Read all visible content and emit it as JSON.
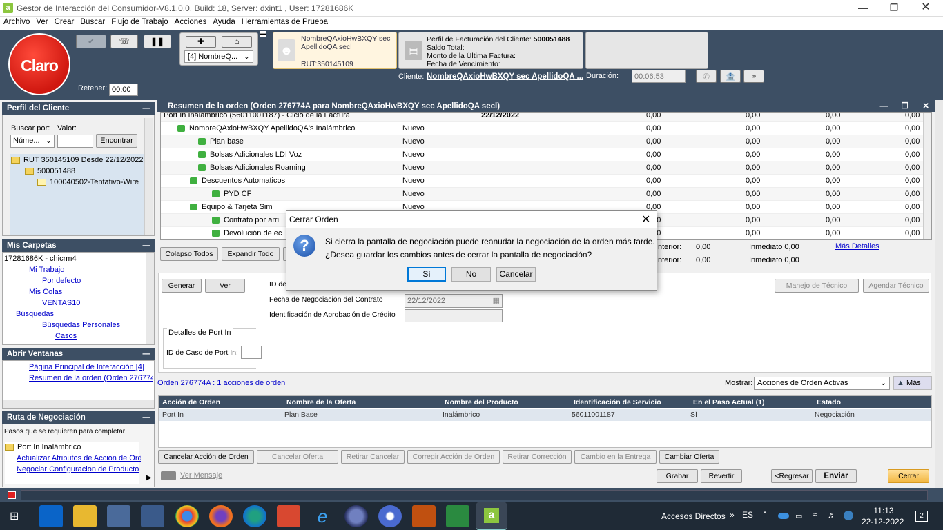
{
  "title": "Gestor de Interacción del Consumidor-V8.1.0.0, Build: 18, Server: dxint1 , User: 17281686K",
  "menu": [
    "Archivo",
    "Ver",
    "Crear",
    "Buscar",
    "Flujo de Trabajo",
    "Acciones",
    "Ayuda",
    "Herramientas de Prueba"
  ],
  "toolbar": {
    "logo": "Claro",
    "retener_label": "Retener:",
    "retener_value": "00:00",
    "dropdown": "[4] NombreQ...",
    "contact_name": "NombreQAxioHwBXQY sec ApellidoQA secl",
    "contact_rut": "RUT:350145109",
    "billing_line1_label": "Perfil de Facturación del Cliente:",
    "billing_line1_value": "500051488",
    "billing_line2": "Saldo Total:",
    "billing_line3": "Monto de la Última Factura:",
    "billing_line4": "Fecha de Vencimiento:",
    "client_label": "Cliente:",
    "client_value": "NombreQAxioHwBXQY sec ApellidoQA ...",
    "duration_label": "Duración:",
    "duration_value": "00:06:53"
  },
  "profile": {
    "header": "Perfil del Cliente",
    "search_by_label": "Buscar por:",
    "value_label": "Valor:",
    "search_by_value": "Núme...",
    "find_button": "Encontrar",
    "tree": [
      "RUT 350145109 Desde 22/12/2022",
      "500051488",
      "100040502-Tentativo-Wire"
    ]
  },
  "folders": {
    "header": "Mis Carpetas",
    "items": [
      "17281686K - chicrm4",
      "Mi Trabajo",
      "Por defecto",
      "Mis Colas",
      "VENTAS10",
      "Búsquedas",
      "Búsquedas Personales",
      "Casos"
    ]
  },
  "windows": {
    "header": "Abrir Ventanas",
    "items": [
      "Página Principal de Interacción [4]",
      "Resumen de la orden (Orden 276774A"
    ]
  },
  "route": {
    "header": "Ruta de Negociación",
    "subtitle": "Pasos que se requieren para completar:",
    "items": [
      "Port In Inalámbrico",
      "Actualizar Atributos de Accion de Orde",
      "Negociar Configuracion de Producto"
    ]
  },
  "main": {
    "header": "Resumen de la orden (Orden 276774A para NombreQAxioHwBXQY sec ApellidoQA secl)",
    "rows": [
      {
        "name": "Port In Inalámbrico (56011001187) - Ciclo de la Factura",
        "status": "",
        "date": "22/12/2022",
        "v1": "0,00",
        "v2": "0,00",
        "v3": "0,00",
        "v4": "0,00"
      },
      {
        "name": "NombreQAxioHwBXQY ApellidoQA's Inalámbrico",
        "status": "Nuevo",
        "date": "",
        "v1": "0,00",
        "v2": "0,00",
        "v3": "0,00",
        "v4": "0,00"
      },
      {
        "name": "Plan base",
        "status": "Nuevo",
        "date": "",
        "v1": "0,00",
        "v2": "0,00",
        "v3": "0,00",
        "v4": "0,00"
      },
      {
        "name": "Bolsas Adicionales LDI Voz",
        "status": "Nuevo",
        "date": "",
        "v1": "0,00",
        "v2": "0,00",
        "v3": "0,00",
        "v4": "0,00"
      },
      {
        "name": "Bolsas Adicionales Roaming",
        "status": "Nuevo",
        "date": "",
        "v1": "0,00",
        "v2": "0,00",
        "v3": "0,00",
        "v4": "0,00"
      },
      {
        "name": "Descuentos Automaticos",
        "status": "Nuevo",
        "date": "",
        "v1": "0,00",
        "v2": "0,00",
        "v3": "0,00",
        "v4": "0,00"
      },
      {
        "name": "PYD CF",
        "status": "Nuevo",
        "date": "",
        "v1": "0,00",
        "v2": "0,00",
        "v3": "0,00",
        "v4": "0,00"
      },
      {
        "name": "Equipo & Tarjeta Sim",
        "status": "Nuevo",
        "date": "",
        "v1": "0,00",
        "v2": "0,00",
        "v3": "0,00",
        "v4": "0,00"
      },
      {
        "name": "Contrato por arri",
        "status": "",
        "date": "",
        "v1": "0,00",
        "v2": "0,00",
        "v3": "0,00",
        "v4": "0,00"
      },
      {
        "name": "Devolución de ec",
        "status": "",
        "date": "",
        "v1": "0,00",
        "v2": "0,00",
        "v3": "0,00",
        "v4": "0,00"
      }
    ],
    "collapse_btn": "Colapso Todos",
    "expand_btn": "Expandir Todo",
    "anterior1_label": "nterior:",
    "anterior1_value": "0,00",
    "anterior2_label": "nterior:",
    "anterior2_value": "0,00",
    "inmediato1": "Inmediato 0,00",
    "inmediato2": "Inmediato 0,00",
    "more_details": "Más Detalles",
    "generate_btn": "Generar",
    "view_btn": "Ver",
    "id_label": "ID de",
    "contract_date_label": "Fecha de Negociación del Contrato",
    "contract_date_value": "22/12/2022",
    "credit_label": "Identificación de Aprobación de Crédito",
    "tech_btn": "Manejo de Técnico",
    "tech_schedule_btn": "Agendar Técnico",
    "portin_group": "Detalles de Port In",
    "portin_case_label": "ID de Caso de Port In:"
  },
  "actions": {
    "order_link": "Orden 276774A : 1 acciones de orden",
    "show_label": "Mostrar:",
    "show_value": "Acciones de Orden Activas",
    "more": "Más",
    "columns": [
      "Acción de Orden",
      "Nombre de la Oferta",
      "Nombre del Producto",
      "Identificación de Servicio",
      "En el Paso Actual (1)",
      "Estado"
    ],
    "row": [
      "Port In",
      "Plan Base",
      "Inalámbrico",
      "56011001187",
      "SÍ",
      "Negociación"
    ],
    "buttons": [
      "Cancelar Acción de Orden",
      "Cancelar Oferta",
      "Retirar Cancelar",
      "Corregir Acción de Orden",
      "Retirar Corrección",
      "Cambio en la Entrega",
      "Cambiar Oferta"
    ],
    "view_message": "Ver Mensaje",
    "save": "Grabar",
    "revert": "Revertir",
    "back": "<Regresar",
    "send": "Enviar",
    "close": "Cerrar"
  },
  "dialog": {
    "title": "Cerrar Orden",
    "line1": "Si cierra la pantalla de negociación puede reanudar la negociación de la orden más tarde.",
    "line2": "¿Desea guardar los cambios antes de cerrar la pantalla de negociación?",
    "yes": "Sí",
    "no": "No",
    "cancel": "Cancelar"
  },
  "taskbar": {
    "shortcuts": "Accesos Directos",
    "lang": "ES",
    "time": "11:13",
    "date": "22-12-2022",
    "notifications": "2"
  }
}
